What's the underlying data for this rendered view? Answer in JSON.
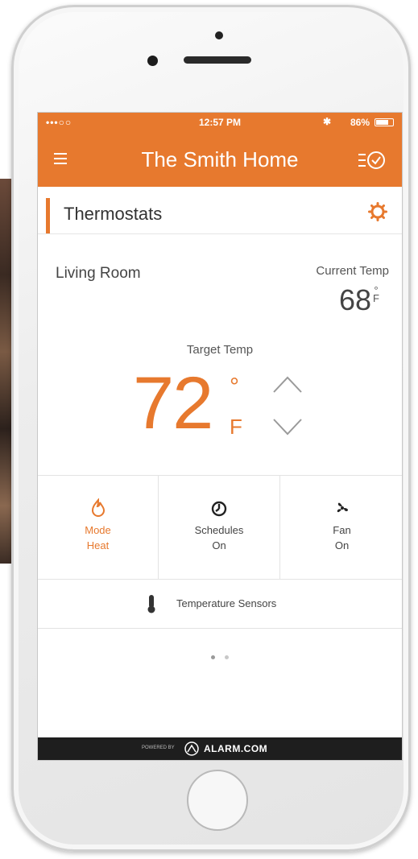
{
  "status_bar": {
    "carrier": "•••○○ ",
    "time": "12:57 PM",
    "battery": "86%"
  },
  "header": {
    "title": "The Smith Home",
    "menu_icon": "menu-icon",
    "activity_icon": "activity-clock-icon"
  },
  "section": {
    "title": "Thermostats",
    "settings_icon": "gear-icon"
  },
  "thermostat": {
    "room": "Living Room",
    "current_label": "Current Temp",
    "current_value": "68",
    "current_deg": "°",
    "current_unit": "F",
    "target_label": "Target Temp",
    "target_value": "72",
    "target_deg": "°",
    "target_unit": "F"
  },
  "controls": [
    {
      "icon": "flame-icon",
      "line1": "Mode",
      "line2": "Heat"
    },
    {
      "icon": "schedule-clock-icon",
      "line1": "Schedules",
      "line2": "On"
    },
    {
      "icon": "fan-icon",
      "line1": "Fan",
      "line2": "On"
    }
  ],
  "sensors": {
    "icon": "thermometer-icon",
    "label": "Temperature Sensors"
  },
  "pager": {
    "count": 2,
    "active": 0
  },
  "footer": {
    "powered": "POWERED BY",
    "brand": "ALARM.COM"
  },
  "colors": {
    "accent": "#e7792e",
    "footer": "#1e1e1e"
  }
}
